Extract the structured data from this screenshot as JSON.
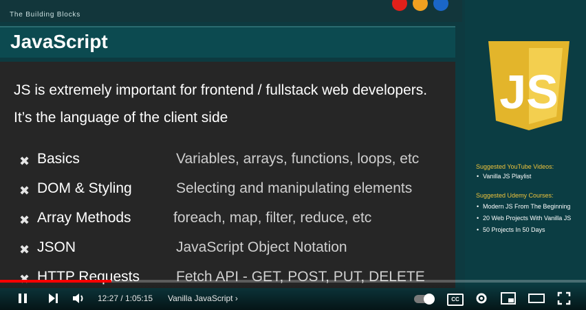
{
  "slide": {
    "header": "The Building Blocks",
    "title": "JavaScript",
    "intro": "JS is extremely important for frontend / fullstack web developers. It’s the language of the client side",
    "rows": [
      {
        "term": "Basics",
        "desc": "Variables, arrays, functions, loops, etc"
      },
      {
        "term": "DOM & Styling",
        "desc": "Selecting and manipulating elements"
      },
      {
        "term": "Array Methods",
        "desc": "foreach, map, filter, reduce, etc"
      },
      {
        "term": "JSON",
        "desc": "JavaScript Object Notation"
      },
      {
        "term": "HTTP Requests",
        "desc": "Fetch API - GET, POST, PUT, DELETE"
      }
    ]
  },
  "sidebar": {
    "logo_text": "JS",
    "youtube_header": "Suggested YouTube Videos:",
    "youtube_items": [
      "Vanilla JS Playlist"
    ],
    "udemy_header": "Suggested Udemy Courses:",
    "udemy_items": [
      "Modern JS From The Beginning",
      "20 Web Projects With Vanilla JS",
      "50 Projects In 50 Days"
    ]
  },
  "player": {
    "time": "12:27 / 1:05:15",
    "chapter": "Vanilla JavaScript",
    "progress": 0.19,
    "cc_label": "CC",
    "icons": {
      "pause": "pause-icon",
      "next": "next-icon",
      "volume": "volume-icon",
      "settings": "gear-icon",
      "miniplayer": "miniplayer-icon",
      "theater": "theater-icon",
      "fullscreen": "fullscreen-icon"
    }
  },
  "colors": {
    "accent": "#f0c43b",
    "panel": "#0b3d43",
    "slide_bg": "#262626",
    "progress": "#ff0000",
    "dot_red": "#e0201a",
    "dot_orange": "#f0a020",
    "dot_blue": "#1a66c8"
  }
}
